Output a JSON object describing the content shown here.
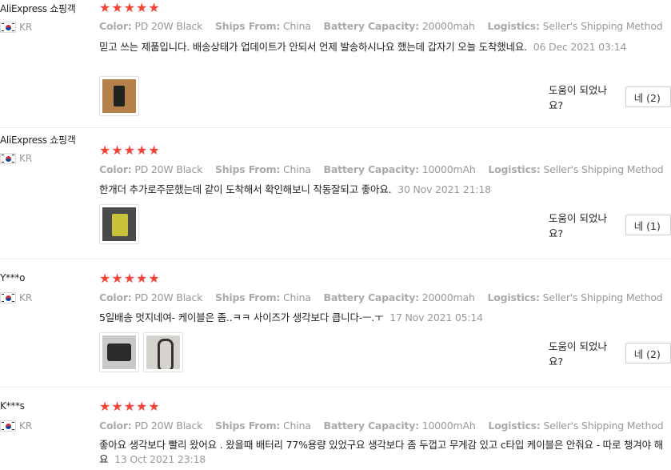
{
  "reviews": [
    {
      "user": "AliExpress 쇼핑객",
      "country": "KR",
      "rating": 5,
      "attrs": [
        {
          "k": "Color:",
          "v": "PD 20W Black"
        },
        {
          "k": "Ships From:",
          "v": "China"
        },
        {
          "k": "Battery Capacity:",
          "v": "20000mah"
        },
        {
          "k": "Logistics:",
          "v": "Seller's Shipping Method"
        }
      ],
      "text": "믿고 쓰는 제품입니다. 배송상태가 업데이트가 안되서 언제 발송하시나요 했는데 갑자기 오늘 도착했네요.",
      "date": "06 Dec 2021 03:14",
      "images": [
        "product-photo"
      ],
      "helpful_label": "도움이 되었나요?",
      "yes_button": "네 (2)"
    },
    {
      "user": "AliExpress 쇼핑객",
      "country": "KR",
      "rating": 5,
      "attrs": [
        {
          "k": "Color:",
          "v": "PD 20W Black"
        },
        {
          "k": "Ships From:",
          "v": "China"
        },
        {
          "k": "Battery Capacity:",
          "v": "10000mAh"
        },
        {
          "k": "Logistics:",
          "v": "Seller's Shipping Method"
        }
      ],
      "text": "한개더 추가로주문했는데 같이 도착해서 확인해보니 작동잘되고 좋아요.",
      "date": "30 Nov 2021 21:18",
      "images": [
        "product-photo"
      ],
      "helpful_label": "도움이 되었나요?",
      "yes_button": "네 (1)"
    },
    {
      "user": "Y***o",
      "country": "KR",
      "rating": 5,
      "attrs": [
        {
          "k": "Color:",
          "v": "PD 20W Black"
        },
        {
          "k": "Ships From:",
          "v": "China"
        },
        {
          "k": "Battery Capacity:",
          "v": "20000mah"
        },
        {
          "k": "Logistics:",
          "v": "Seller's Shipping Method"
        }
      ],
      "text": "5일배송 멋지네여- 케이블은 좀..ㅋㅋ 사이즈가 생각보다 큽니다-ㅡ.ㅜ",
      "date": "17 Nov 2021 05:14",
      "images": [
        "product-photo",
        "cable-photo"
      ],
      "helpful_label": "도움이 되었나요?",
      "yes_button": "네 (2)"
    },
    {
      "user": "K***s",
      "country": "KR",
      "rating": 5,
      "attrs": [
        {
          "k": "Color:",
          "v": "PD 20W Black"
        },
        {
          "k": "Ships From:",
          "v": "China"
        },
        {
          "k": "Battery Capacity:",
          "v": "10000mAh"
        },
        {
          "k": "Logistics:",
          "v": "Seller's Shipping Method"
        }
      ],
      "text": "좋아요 생각보다 빨리 왔어요 . 왔을때 배터리 77%용량 있었구요 생각보다 좀 두껍고 무게감 있고 c타입 케이블은 안줘요 - 따로 챙겨야 해요",
      "date": "13 Oct 2021 23:18",
      "images": [],
      "helpful_label": "",
      "yes_button": ""
    }
  ],
  "colors": {
    "star": "#f44336",
    "muted": "#999999",
    "border": "#ececec"
  },
  "icons": {
    "star": "star-icon",
    "flag": "flag-kr-icon"
  }
}
